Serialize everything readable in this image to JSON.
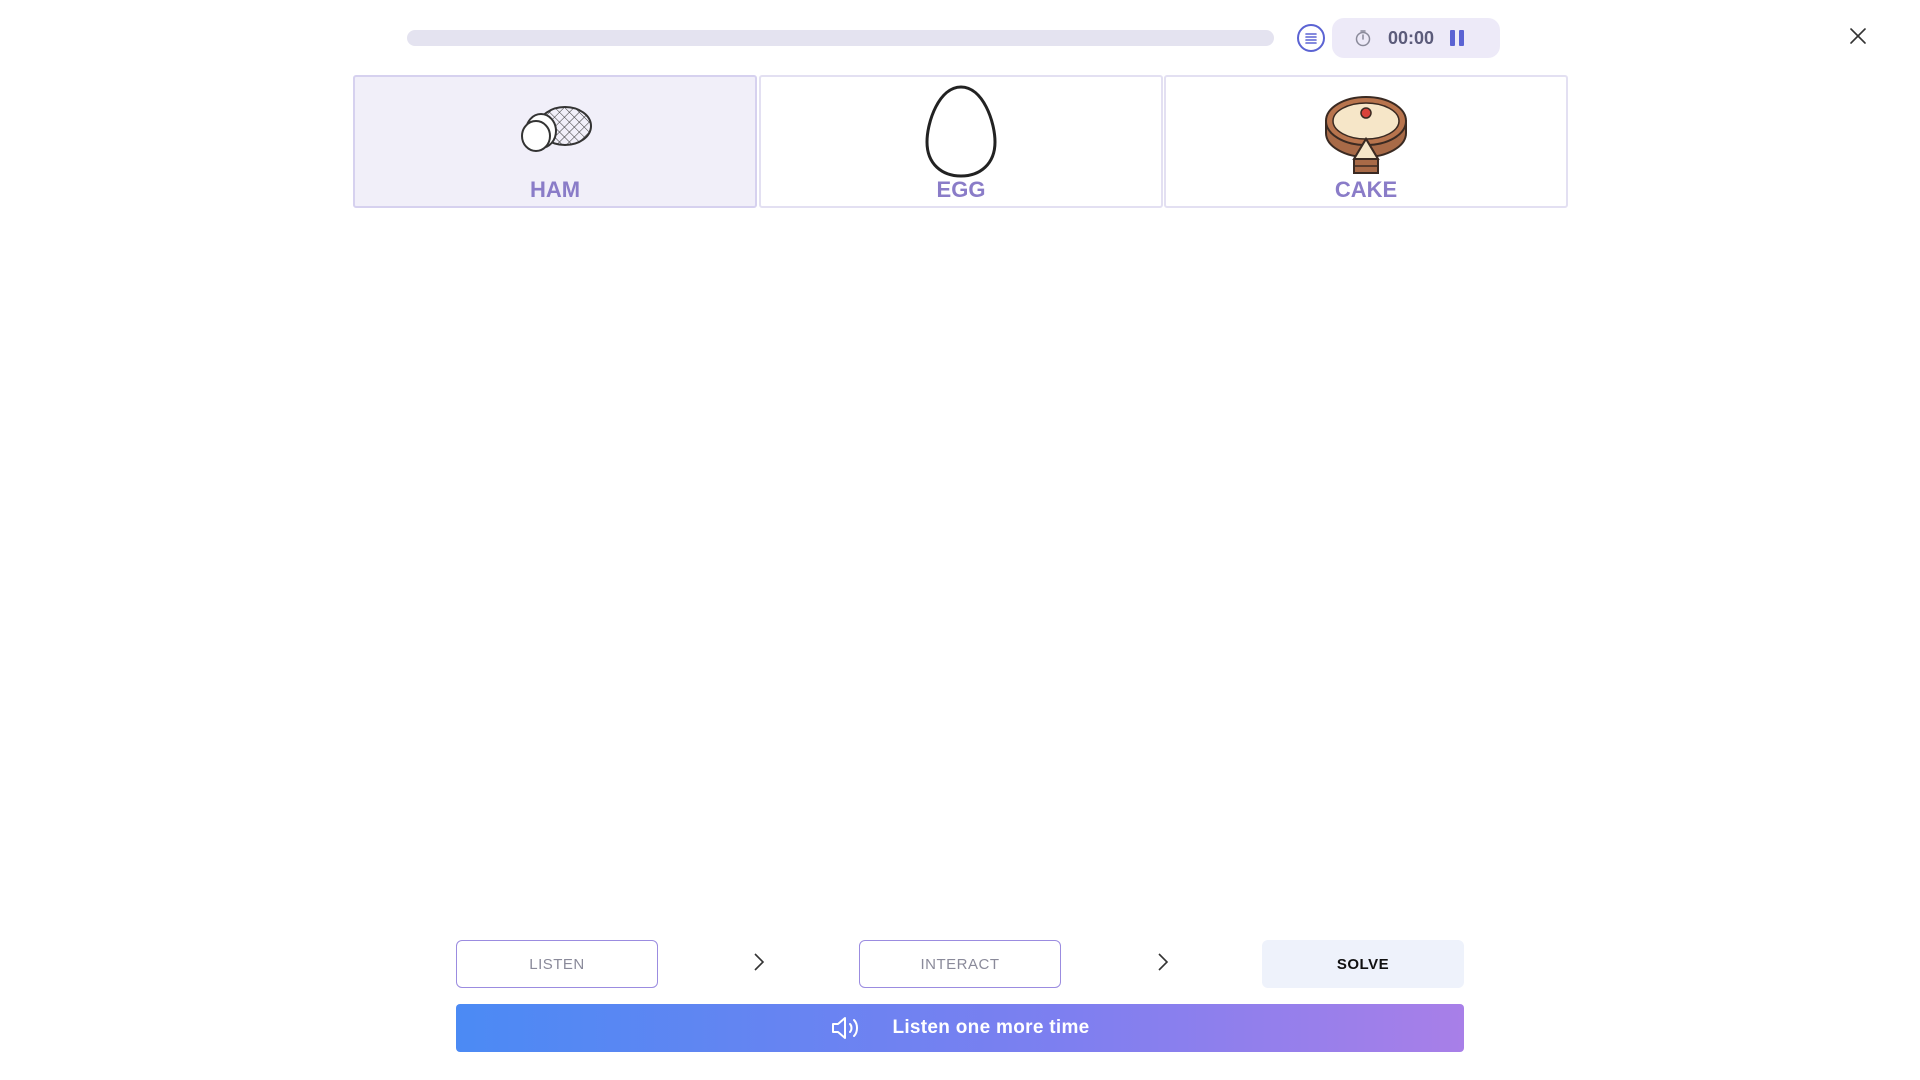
{
  "progress": {
    "value": 0
  },
  "timer": {
    "time": "00:00"
  },
  "cards": [
    {
      "label": "HAM",
      "selected": true
    },
    {
      "label": "EGG",
      "selected": false
    },
    {
      "label": "CAKE",
      "selected": false
    }
  ],
  "steps": {
    "listen": "LISTEN",
    "interact": "INTERACT",
    "solve": "SOLVE"
  },
  "listen_button": {
    "label": "Listen one more time"
  },
  "icons": {
    "menu": "list-icon",
    "timer": "stopwatch-icon",
    "pause": "pause-icon",
    "close": "close-icon",
    "sound": "speaker-icon"
  },
  "colors": {
    "accent": "#5b63d3",
    "label": "#8a7cc8",
    "gradient_start": "#4b8af4",
    "gradient_end": "#a87fe8"
  }
}
